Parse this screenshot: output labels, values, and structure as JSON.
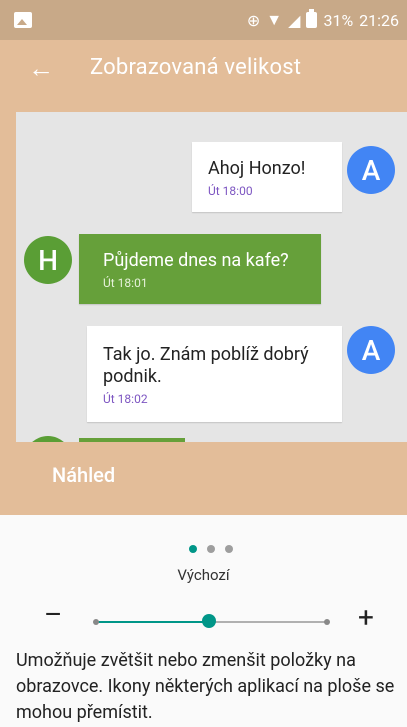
{
  "status_bar": {
    "battery_percent": "31%",
    "time": "21:26"
  },
  "app_bar": {
    "title": "Zobrazovaná velikost"
  },
  "preview": {
    "messages": [
      {
        "sender": "A",
        "text": "Ahoj Honzo!",
        "time": "Út 18:00"
      },
      {
        "sender": "H",
        "text": "Půjdeme dnes na kafe?",
        "time": "Út 18:01"
      },
      {
        "sender": "A",
        "text": "Tak jo. Znám poblíž dobrý podnik.",
        "time": "Út 18:02"
      }
    ],
    "label": "Náhled"
  },
  "display_size": {
    "current": "Výchozí",
    "pages": 3,
    "active_page": 1,
    "minus_label": "–",
    "plus_label": "+",
    "level_index": 1,
    "levels": 3
  },
  "description": "Umožňuje zvětšit nebo zmenšit položky na obrazovce. Ikony některých aplikací na ploše se mohou přemístit.",
  "colors": {
    "accent": "#009688",
    "appbar": "#e3bd99",
    "statusbar": "#c8a988",
    "avatar_a": "#4285f4",
    "avatar_h": "#5a9e35",
    "bubble_green": "#66a03a",
    "time_purple": "#7e57c2"
  }
}
